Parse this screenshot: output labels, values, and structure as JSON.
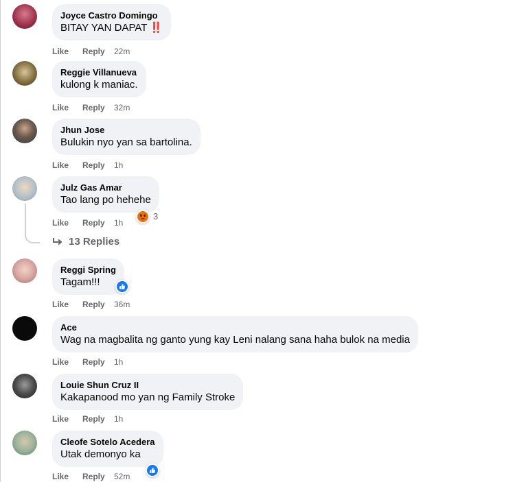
{
  "actions": {
    "like": "Like",
    "reply": "Reply"
  },
  "comments": [
    {
      "author": "Joyce Castro Domingo",
      "text": "BITAY YAN DAPAT",
      "emoji": "‼️",
      "time": "22m"
    },
    {
      "author": "Reggie Villanueva",
      "text": "kulong k maniac.",
      "time": "32m"
    },
    {
      "author": "Jhun Jose",
      "text": "Bulukin nyo yan sa bartolina.",
      "time": "1h"
    },
    {
      "author": "Julz Gas Amar",
      "text": "Tao lang po hehehe",
      "time": "1h",
      "reaction": "angry-icon",
      "reaction_count": "3"
    },
    {
      "author": "Reggi Spring",
      "text": "Tagam!!!",
      "time": "36m",
      "reaction": "like-icon"
    },
    {
      "author": "Ace",
      "text": "Wag na magbalita ng ganto yung kay Leni nalang sana haha bulok na media",
      "time": "1h"
    },
    {
      "author": "Louie Shun Cruz II",
      "text": "Kakapanood mo yan ng Family Stroke",
      "time": "1h"
    },
    {
      "author": "Cleofe Sotelo Acedera",
      "text": "Utak demonyo ka",
      "time": "52m",
      "reaction": "like-icon"
    }
  ],
  "replies_link": "13 Replies",
  "colors": {
    "bubble": "#f0f2f5",
    "meta": "#65676b",
    "like_blue": "#1877f2",
    "angry": "#e9710f"
  }
}
